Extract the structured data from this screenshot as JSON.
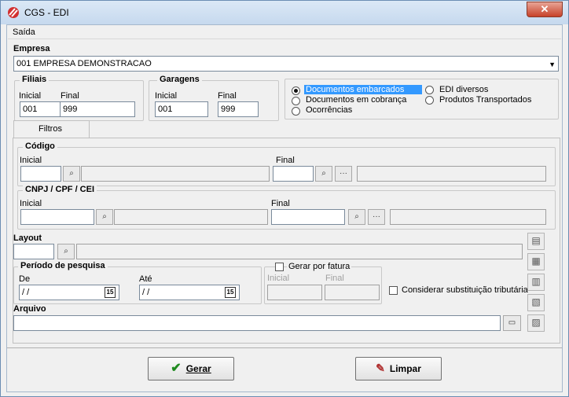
{
  "window": {
    "title": "CGS - EDI",
    "close_label": "✕"
  },
  "menu": {
    "saida": "Saída"
  },
  "empresa": {
    "label": "Empresa",
    "value": "001 EMPRESA DEMONSTRACAO"
  },
  "filiais": {
    "title": "Filiais",
    "inicial_label": "Inicial",
    "inicial_value": "001",
    "final_label": "Final",
    "final_value": "999"
  },
  "garagens": {
    "title": "Garagens",
    "inicial_label": "Inicial",
    "inicial_value": "001",
    "final_label": "Final",
    "final_value": "999"
  },
  "doc_types": {
    "selected": "Documentos embarcados",
    "options": [
      "Documentos embarcados",
      "Documentos em cobrança",
      "Ocorrências",
      "EDI diversos",
      "Produtos Transportados"
    ]
  },
  "tabs": {
    "filtros": "Filtros"
  },
  "codigo": {
    "title": "Código",
    "inicial_label": "Inicial",
    "final_label": "Final",
    "ellipsis": "···"
  },
  "cnpj": {
    "title": "CNPJ / CPF / CEI",
    "inicial_label": "Inicial",
    "final_label": "Final",
    "ellipsis": "···"
  },
  "layout": {
    "label": "Layout"
  },
  "periodo": {
    "title": "Período de pesquisa",
    "de_label": "De",
    "de_value": " /  /",
    "ate_label": "Até",
    "ate_value": " /  /",
    "cal_day": "15"
  },
  "gerar_fatura": {
    "label": "Gerar por fatura",
    "checked": false,
    "inicial_label": "Inicial",
    "final_label": "Final"
  },
  "substituicao": {
    "label": "Considerar substituição tributária",
    "checked": false
  },
  "arquivo": {
    "label": "Arquivo",
    "value": ""
  },
  "buttons": {
    "gerar": "Gerar",
    "limpar": "Limpar"
  },
  "colors": {
    "accent": "#3399ff",
    "titlebar": "#c6d9ee",
    "close": "#c7422a"
  }
}
